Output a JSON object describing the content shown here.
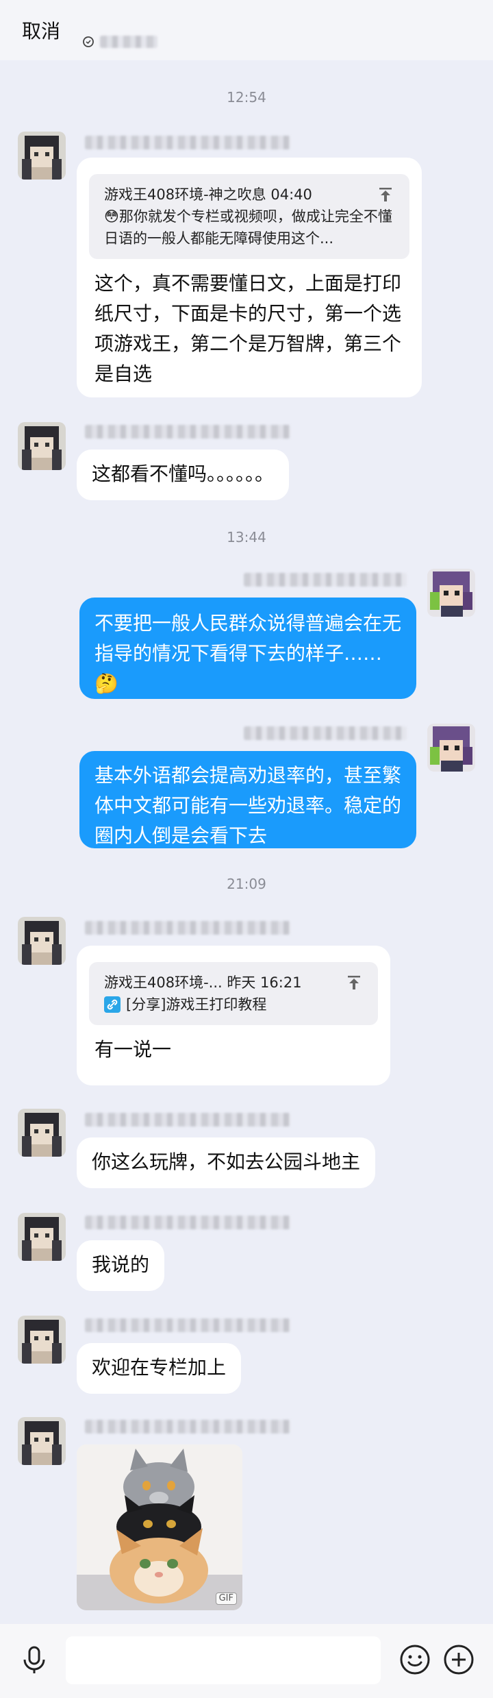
{
  "header": {
    "cancel_label": "取消"
  },
  "messages": [
    {
      "type": "time",
      "text": "12:54"
    },
    {
      "type": "msg",
      "side": "left",
      "quote": {
        "title": "游戏王408环境-神之吹息",
        "time": "04:40",
        "text": "😳那你就发个专栏或视频呗，做成让完全不懂日语的一般人都能无障碍使用这个..."
      },
      "text": "这个，真不需要懂日文，上面是打印纸尺寸，下面是卡的尺寸，第一个选项游戏王，第二个是万智牌，第三个是自选"
    },
    {
      "type": "msg",
      "side": "left",
      "text": "这都看不懂吗。。。。。。"
    },
    {
      "type": "time",
      "text": "13:44"
    },
    {
      "type": "msg",
      "side": "right",
      "text": "不要把一般人民群众说得普遍会在无指导的情况下看得下去的样子……🤔"
    },
    {
      "type": "msg",
      "side": "right",
      "text": "基本外语都会提高劝退率的，甚至繁体中文都可能有一些劝退率。稳定的圈内人倒是会看下去"
    },
    {
      "type": "time",
      "text": "21:09"
    },
    {
      "type": "msg",
      "side": "left",
      "quote": {
        "title": "游戏王408环境-...",
        "time": "昨天 16:21",
        "text": "[分享]游戏王打印教程"
      },
      "text": "有一说一"
    },
    {
      "type": "msg",
      "side": "left",
      "text": "你这么玩牌，不如去公园斗地主"
    },
    {
      "type": "msg",
      "side": "left",
      "text": "我说的"
    },
    {
      "type": "msg",
      "side": "left",
      "text": "欢迎在专栏加上"
    },
    {
      "type": "msg",
      "side": "left",
      "image": "stacked-cats-gif",
      "badge": "GIF"
    }
  ],
  "colors": {
    "background": "#eceef7",
    "my_bubble": "#1a9bfc",
    "other_bubble": "#ffffff"
  },
  "icons": [
    "microphone-icon",
    "emoji-icon",
    "plus-icon",
    "upload-icon",
    "link-icon",
    "clock-icon"
  ]
}
